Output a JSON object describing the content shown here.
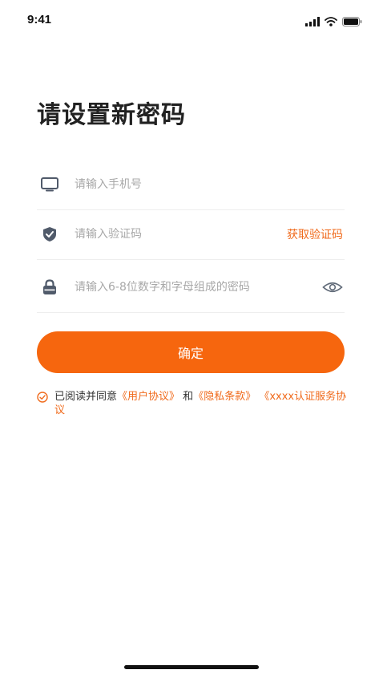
{
  "status_bar": {
    "time": "9:41",
    "icons": [
      "signal-icon",
      "wifi-icon",
      "battery-icon"
    ]
  },
  "page": {
    "title": "请设置新密码"
  },
  "form": {
    "phone": {
      "placeholder": "请输入手机号",
      "value": "",
      "icon": "phone-icon"
    },
    "code": {
      "placeholder": "请输入验证码",
      "value": "",
      "icon": "shield-check-icon",
      "get_code_label": "获取验证码"
    },
    "password": {
      "placeholder": "请输入6-8位数字和字母组成的密码",
      "value": "",
      "icon": "lock-icon",
      "toggle_icon": "eye-icon"
    }
  },
  "confirm_label": "确定",
  "agreement": {
    "prefix": "已阅读并同意",
    "user_agreement": "《用户协议》",
    "and": "和",
    "privacy": "《隐私条款》",
    "auth_service": "《xxxx认证服务协议"
  },
  "colors": {
    "accent": "#f6660e",
    "link": "#f06a1b",
    "placeholder": "#a8a8a8",
    "icon": "#505a6a"
  }
}
